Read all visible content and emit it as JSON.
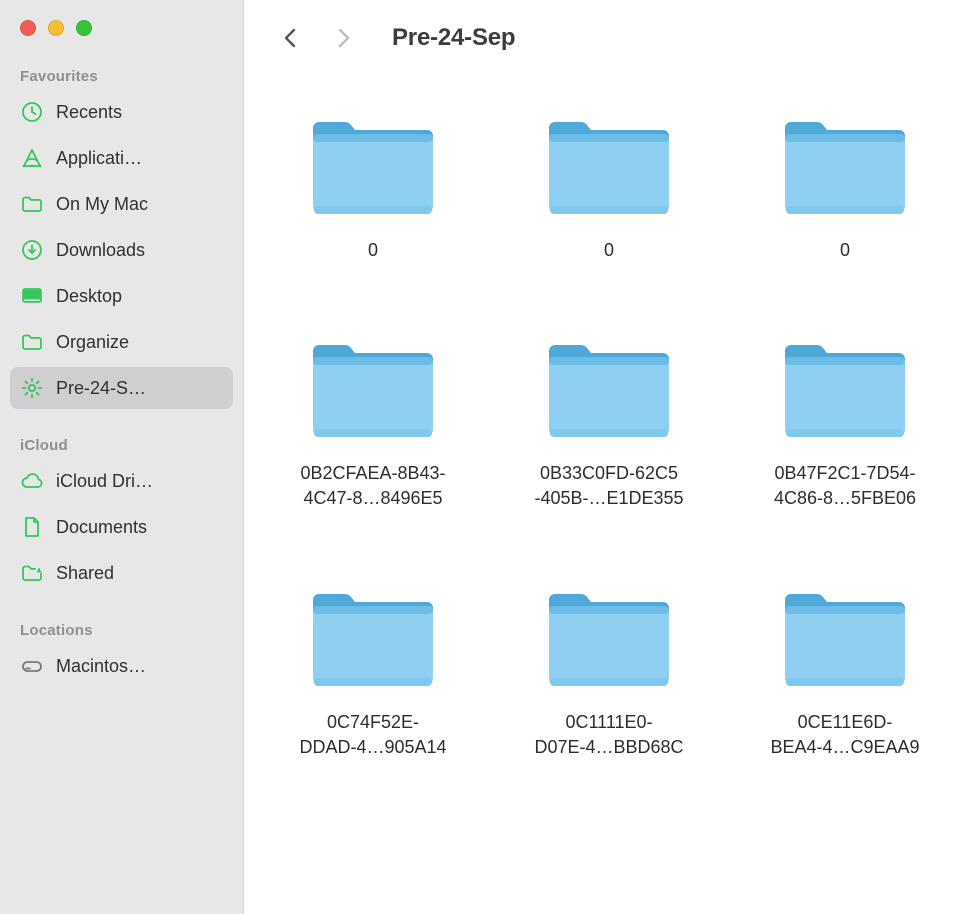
{
  "window": {
    "title": "Pre-24-Sep"
  },
  "sidebar": {
    "sections": [
      {
        "header": "Favourites",
        "items": [
          {
            "icon": "clock-icon",
            "label": "Recents",
            "selected": false
          },
          {
            "icon": "app-icon",
            "label": "Applicati…",
            "selected": false
          },
          {
            "icon": "folder-outline-icon",
            "label": "On My Mac",
            "selected": false
          },
          {
            "icon": "download-icon",
            "label": "Downloads",
            "selected": false
          },
          {
            "icon": "desktop-icon",
            "label": "Desktop",
            "selected": false
          },
          {
            "icon": "folder-outline-icon",
            "label": "Organize",
            "selected": false
          },
          {
            "icon": "gear-icon",
            "label": "Pre-24-S…",
            "selected": true
          }
        ]
      },
      {
        "header": "iCloud",
        "items": [
          {
            "icon": "cloud-icon",
            "label": "iCloud Dri…",
            "selected": false
          },
          {
            "icon": "document-icon",
            "label": "Documents",
            "selected": false
          },
          {
            "icon": "shared-folder-icon",
            "label": "Shared",
            "selected": false
          }
        ]
      },
      {
        "header": "Locations",
        "items": [
          {
            "icon": "disk-icon",
            "label": "Macintos…",
            "selected": false
          }
        ]
      }
    ]
  },
  "folders": [
    {
      "line1": "0",
      "line2": ""
    },
    {
      "line1": "0",
      "line2": ""
    },
    {
      "line1": "0",
      "line2": ""
    },
    {
      "line1": "0B2CFAEA-8B43-",
      "line2": "4C47-8…8496E5"
    },
    {
      "line1": "0B33C0FD-62C5",
      "line2": "-405B-…E1DE355"
    },
    {
      "line1": "0B47F2C1-7D54-",
      "line2": "4C86-8…5FBE06"
    },
    {
      "line1": "0C74F52E-",
      "line2": "DDAD-4…905A14"
    },
    {
      "line1": "0C1111E0-",
      "line2": "D07E-4…BBD68C"
    },
    {
      "line1": "0CE11E6D-",
      "line2": "BEA4-4…C9EAA9"
    }
  ],
  "colors": {
    "accent": "#34c759",
    "sidebar_bg": "#e7e7e8",
    "selected_bg": "#cfcfd1"
  }
}
